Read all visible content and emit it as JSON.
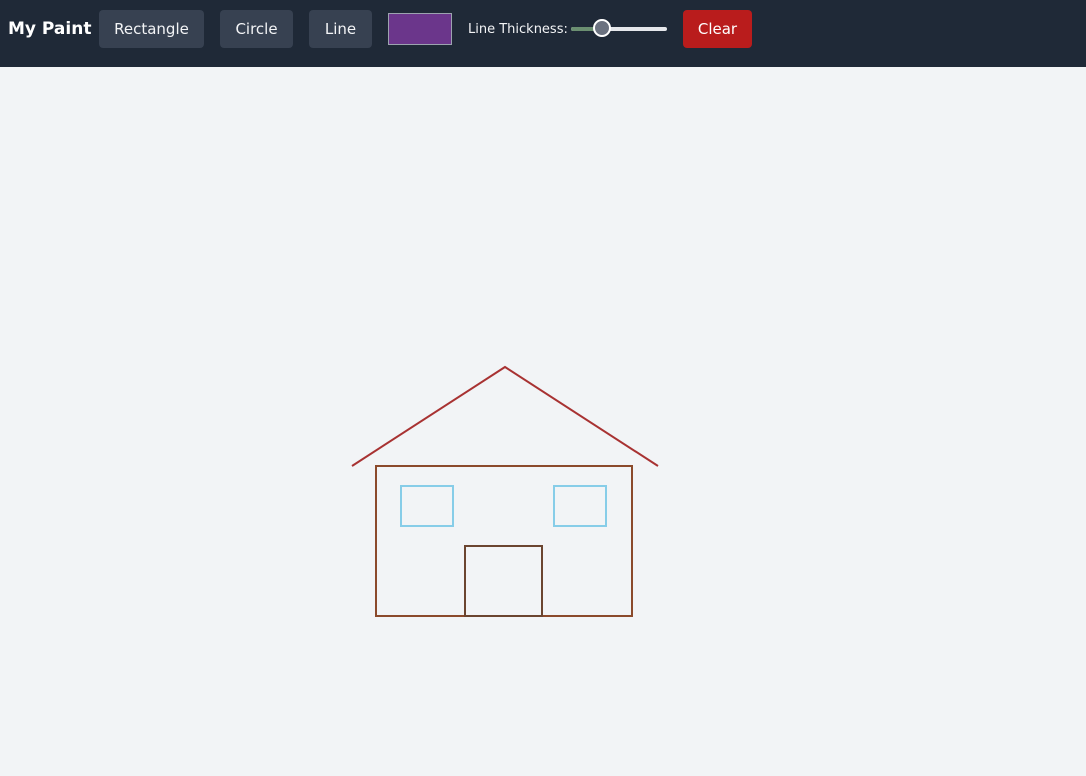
{
  "app": {
    "title": "My Paint"
  },
  "toolbar": {
    "rectangle_label": "Rectangle",
    "circle_label": "Circle",
    "line_label": "Line",
    "current_color": "#6b368b",
    "thickness_label": "Line Thickness:",
    "thickness_fraction": 0.28,
    "clear_label": "Clear"
  },
  "canvas": {
    "background": "#f2f4f6",
    "shapes": [
      {
        "kind": "roof-line",
        "color": "#a83232"
      },
      {
        "kind": "house-body-rectangle",
        "color": "#8b4a2b"
      },
      {
        "kind": "left-window-rectangle",
        "color": "#87cde8"
      },
      {
        "kind": "right-window-rectangle",
        "color": "#87cde8"
      },
      {
        "kind": "door-rectangle",
        "color": "#6b4530"
      }
    ]
  }
}
